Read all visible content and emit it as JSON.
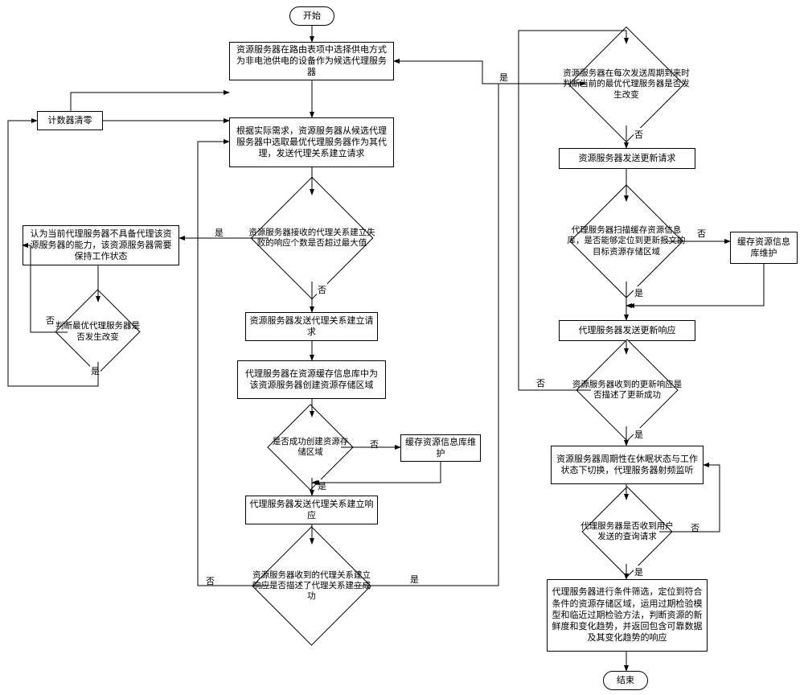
{
  "terminals": {
    "start": "开始",
    "end": "结束"
  },
  "boxes": {
    "b1": "资源服务器在路由表项中选择供电方式为非电池供电的设备作为候选代理服务器",
    "b2": "根据实际需求，资源服务器从候选代理服务器中选取最优代理服务器作为其代理，发送代理关系建立请求",
    "b3_left": "认为当前代理服务器不具备代理该资源服务器的能力，该资源服务器需要保持工作状态",
    "b4": "资源服务器发送代理关系建立请求",
    "b5": "代理服务器在资源缓存信息库中为该资源服务器创建资源存储区域",
    "b6_maint": "缓存资源信息库维护",
    "b7": "代理服务器发送代理关系建立响应",
    "b_counter": "计数器清零",
    "b_r1": "资源服务器发送更新请求",
    "b_r2_maint": "缓存资源信息库维护",
    "b_r3": "代理服务器发送更新响应",
    "b_r4": "资源服务器周期性在休眠状态与工作状态下切换，代理服务器射频监听",
    "b_r5": "代理服务器进行条件筛选，定位到符合条件的资源存储区域，运用过期检验模型和临近过期检验方法，判断资源的新鲜度和变化趋势，并返回包含可靠数据及其变化趋势的响应"
  },
  "diamonds": {
    "d_fail": "资源服务器接收的代理关系建立失败的响应个数是否超过最大值",
    "d_opt_change": "判断最优代理服务器是否发生改变",
    "d_create": "是否成功创建资源存储区域",
    "d_estab_ok": "资源服务器收到的代理关系建立响应是否描述了代理关系建立成功",
    "d_cycle": "资源服务器在每次发送周期到来时判断当前的最优代理服务器是否发生改变",
    "d_locate": "代理服务器扫描缓存资源信息库，是否能够定位到更新报文的目标资源存储区域",
    "d_upd_ok": "资源服务器收到的更新响应是否描述了更新成功",
    "d_query": "代理服务器是否收到用户发送的查询请求"
  },
  "labels": {
    "yes": "是",
    "no": "否"
  }
}
